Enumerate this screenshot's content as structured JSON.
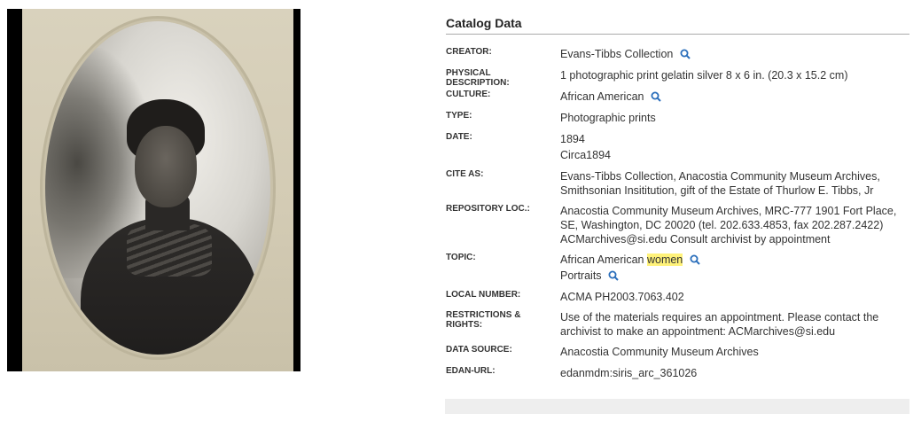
{
  "catalog": {
    "title": "Catalog Data",
    "creator": {
      "label": "CREATOR:",
      "value": "Evans-Tibbs Collection"
    },
    "physical": {
      "label": "PHYSICAL DESCRIPTION:",
      "value": "1 photographic print gelatin silver 8 x 6 in. (20.3 x 15.2 cm)"
    },
    "culture": {
      "label": "CULTURE:",
      "value": "African American"
    },
    "type": {
      "label": "TYPE:",
      "value": "Photographic prints"
    },
    "date": {
      "label": "DATE:",
      "values": [
        "1894",
        "Circa1894"
      ]
    },
    "cite": {
      "label": "CITE AS:",
      "value": "Evans-Tibbs Collection, Anacostia Community Museum Archives, Smithsonian Insititution, gift of the Estate of Thurlow E. Tibbs, Jr"
    },
    "repository": {
      "label": "REPOSITORY LOC.:",
      "value": "Anacostia Community Museum Archives, MRC-777 1901 Fort Place, SE, Washington, DC 20020 (tel. 202.633.4853, fax 202.287.2422) ACMarchives@si.edu Consult archivist by appointment"
    },
    "topic": {
      "label": "TOPIC:",
      "value1_prefix": "African American ",
      "value1_highlight": "women",
      "value2": "Portraits"
    },
    "local": {
      "label": "LOCAL NUMBER:",
      "value": "ACMA PH2003.7063.402"
    },
    "restrictions": {
      "label": "RESTRICTIONS & RIGHTS:",
      "value": "Use of the materials requires an appointment. Please contact the archivist to make an appointment: ACMarchives@si.edu"
    },
    "source": {
      "label": "DATA SOURCE:",
      "value": "Anacostia Community Museum Archives"
    },
    "edan": {
      "label": "EDAN-URL:",
      "value": "edanmdm:siris_arc_361026"
    }
  },
  "colors": {
    "icon": "#2a6ebb",
    "highlight": "#fff27a"
  },
  "icons": [
    "search-icon"
  ]
}
